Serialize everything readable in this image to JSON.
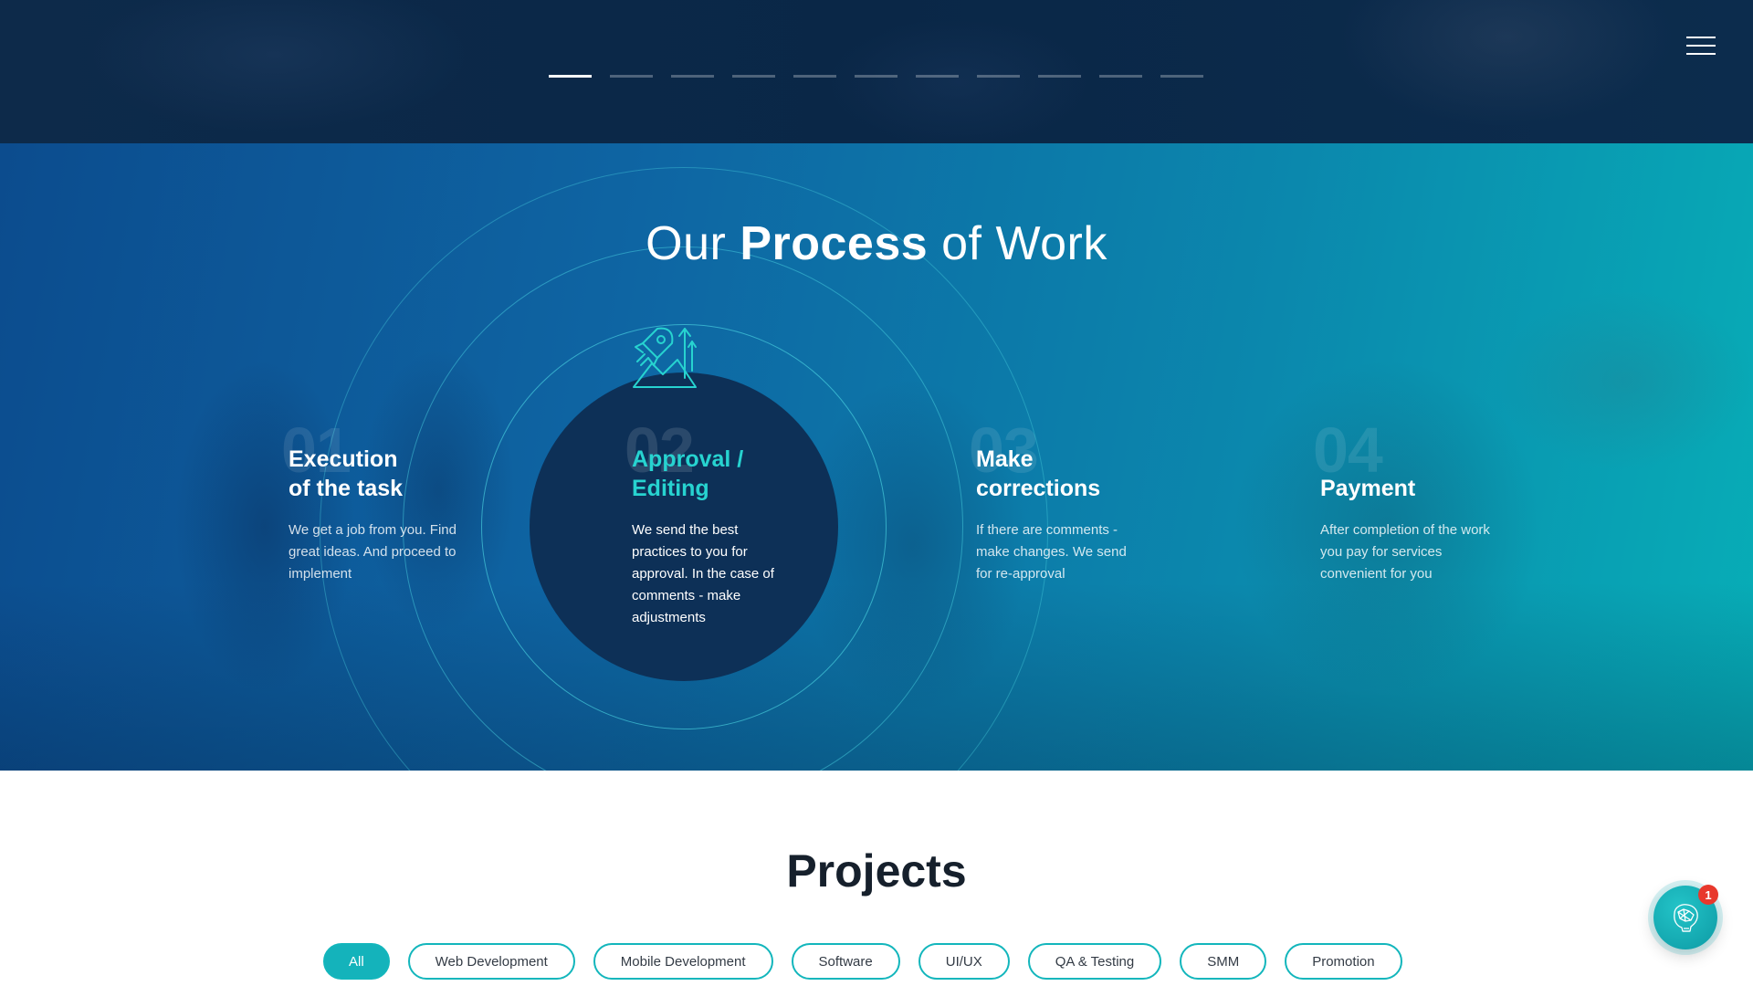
{
  "header": {
    "slider_dot_count": 11,
    "active_slide": 1,
    "menu_icon": "hamburger-menu-icon"
  },
  "process": {
    "title_light_1": "Our ",
    "title_bold": "Process",
    "title_light_2": " of Work",
    "active_step": 2,
    "icon": "rocket-growth-icon",
    "steps": [
      {
        "number": "01",
        "title_line1": "Execution",
        "title_line2": "of the task",
        "description": "We get a job from you. Find great ideas. And proceed to implement"
      },
      {
        "number": "02",
        "title_line1": "Approval /",
        "title_line2": "Editing",
        "description": "We send the best practices to you for approval. In the case of comments - make adjustments"
      },
      {
        "number": "03",
        "title_line1": "Make",
        "title_line2": "corrections",
        "description": "If there are comments - make changes. We send for re-approval"
      },
      {
        "number": "04",
        "title_line1": "",
        "title_line2": "Payment",
        "description": "After completion of the work you pay for services convenient for you"
      }
    ],
    "colors": {
      "accent": "#27d3d0",
      "disc": "#0d3057"
    }
  },
  "projects": {
    "title": "Projects",
    "filters": [
      {
        "label": "All",
        "active": true
      },
      {
        "label": "Web Development",
        "active": false
      },
      {
        "label": "Mobile Development",
        "active": false
      },
      {
        "label": "Software",
        "active": false
      },
      {
        "label": "UI/UX",
        "active": false
      },
      {
        "label": "QA & Testing",
        "active": false
      },
      {
        "label": "SMM",
        "active": false
      },
      {
        "label": "Promotion",
        "active": false
      }
    ],
    "colors": {
      "filter_border": "#13b6bc",
      "filter_active_bg": "#14b3bb"
    }
  },
  "chat": {
    "icon": "brain-chat-icon",
    "badge": "1",
    "badge_color": "#e8382c"
  }
}
